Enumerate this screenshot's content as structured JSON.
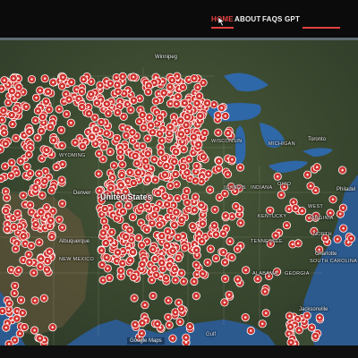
{
  "nav": {
    "items": [
      {
        "label": "HOME",
        "active": true
      },
      {
        "label": "ABOUT",
        "active": false
      },
      {
        "label": "FAQS",
        "active": false
      },
      {
        "label": "GPT",
        "active": false
      },
      {
        "label": "",
        "active": true
      },
      {
        "label": "",
        "active": false
      }
    ]
  },
  "map": {
    "labels": {
      "winnipeg": "Winnipeg",
      "toronto": "Toronto",
      "michigan": "MICHIGAN",
      "wisconsin": "WISCONSIN",
      "illinois": "ILLINOIS",
      "indiana": "INDIANA",
      "ohio": "OHIO",
      "kentucky": "KENTUCKY",
      "tennessee": "TENNESSEE",
      "alabama": "ALABAMA",
      "georgia": "GEORGIA",
      "south_carolina": "SOUTH\nCAROLINA",
      "north_carolina": "NORTH",
      "virginia": "VIRGINIA",
      "west_virginia": "WEST",
      "philadelphia": "Philadel",
      "charlotte": "Charlotte",
      "jacksonville": "Jacksonville",
      "united_states": "United States",
      "denver": "Denver",
      "albuquerque": "Albuquerque",
      "new_mexico": "NEW MEXICO",
      "wyoming": "WYOMING",
      "mexico_area": "Gulf"
    },
    "attribution": "Google Maps",
    "marker_color": "#d0312d",
    "land_color": "#3b4a33",
    "water_color": "#2c5a8f"
  }
}
